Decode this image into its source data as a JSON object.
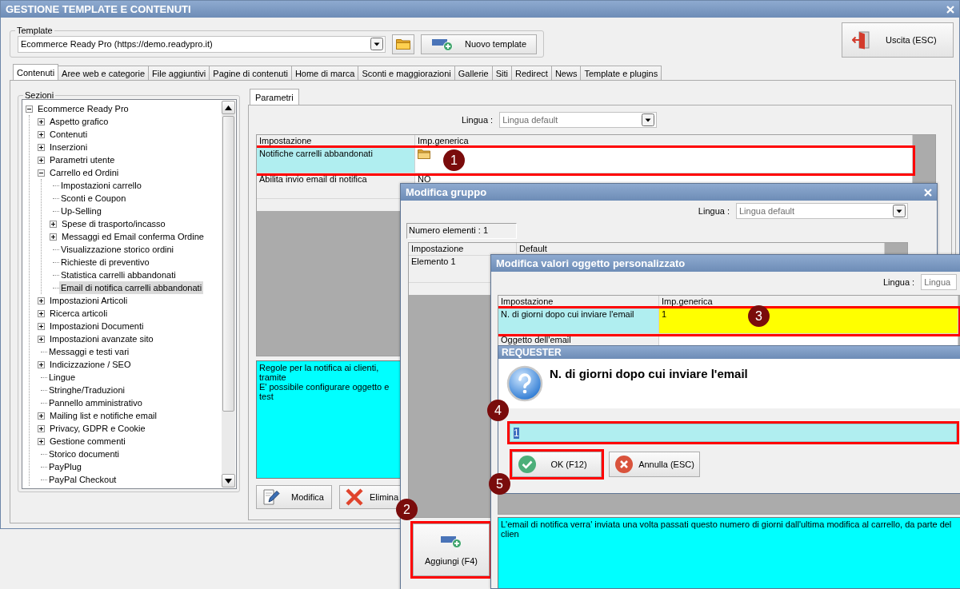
{
  "main_window": {
    "title": "GESTIONE TEMPLATE E CONTENUTI",
    "template": {
      "label": "Template",
      "value": "Ecommerce Ready Pro (https://demo.readypro.it)",
      "new_button": "Nuovo template"
    },
    "exit_button": "Uscita (ESC)",
    "tabs": [
      {
        "label": "Contenuti",
        "selected": true
      },
      {
        "label": "Aree web e categorie",
        "selected": false
      },
      {
        "label": "File aggiuntivi",
        "selected": false
      },
      {
        "label": "Pagine di contenuti",
        "selected": false
      },
      {
        "label": "Home di marca",
        "selected": false
      },
      {
        "label": "Sconti e maggiorazioni",
        "selected": false
      },
      {
        "label": "Gallerie",
        "selected": false
      },
      {
        "label": "Siti",
        "selected": false
      },
      {
        "label": "Redirect",
        "selected": false
      },
      {
        "label": "News",
        "selected": false
      },
      {
        "label": "Template e plugins",
        "selected": false
      }
    ],
    "sections": {
      "label": "Sezioni",
      "tree": [
        {
          "label": "Ecommerce Ready Pro",
          "kind": "group",
          "expanded": true,
          "selected": false,
          "children": [
            {
              "label": "Aspetto grafico",
              "kind": "group",
              "expanded": false,
              "selected": false
            },
            {
              "label": "Contenuti",
              "kind": "group",
              "expanded": false,
              "selected": false
            },
            {
              "label": "Inserzioni",
              "kind": "group",
              "expanded": false,
              "selected": false
            },
            {
              "label": "Parametri utente",
              "kind": "group",
              "expanded": false,
              "selected": false
            },
            {
              "label": "Carrello ed Ordini",
              "kind": "group",
              "expanded": true,
              "selected": false,
              "children": [
                {
                  "label": "Impostazioni carrello",
                  "kind": "leaf",
                  "selected": false
                },
                {
                  "label": "Sconti e Coupon",
                  "kind": "leaf",
                  "selected": false
                },
                {
                  "label": "Up-Selling",
                  "kind": "leaf",
                  "selected": false
                },
                {
                  "label": "Spese di trasporto/incasso",
                  "kind": "group",
                  "expanded": false,
                  "selected": false
                },
                {
                  "label": "Messaggi ed Email conferma Ordine",
                  "kind": "group",
                  "expanded": false,
                  "selected": false
                },
                {
                  "label": "Visualizzazione storico ordini",
                  "kind": "leaf",
                  "selected": false
                },
                {
                  "label": "Richieste di preventivo",
                  "kind": "leaf",
                  "selected": false
                },
                {
                  "label": "Statistica carrelli abbandonati",
                  "kind": "leaf",
                  "selected": false
                },
                {
                  "label": "Email di notifica carrelli abbandonati",
                  "kind": "leaf",
                  "selected": true
                }
              ]
            },
            {
              "label": "Impostazioni Articoli",
              "kind": "group",
              "expanded": false,
              "selected": false
            },
            {
              "label": "Ricerca articoli",
              "kind": "group",
              "expanded": false,
              "selected": false
            },
            {
              "label": "Impostazioni Documenti",
              "kind": "group",
              "expanded": false,
              "selected": false
            },
            {
              "label": "Impostazioni avanzate sito",
              "kind": "group",
              "expanded": false,
              "selected": false
            },
            {
              "label": "Messaggi e testi vari",
              "kind": "leaf",
              "selected": false
            },
            {
              "label": "Indicizzazione / SEO",
              "kind": "group",
              "expanded": false,
              "selected": false
            },
            {
              "label": "Lingue",
              "kind": "leaf",
              "selected": false
            },
            {
              "label": "Stringhe/Traduzioni",
              "kind": "leaf",
              "selected": false
            },
            {
              "label": "Pannello amministrativo",
              "kind": "leaf",
              "selected": false
            },
            {
              "label": "Mailing list e notifiche email",
              "kind": "group",
              "expanded": false,
              "selected": false
            },
            {
              "label": "Privacy, GDPR e Cookie",
              "kind": "group",
              "expanded": false,
              "selected": false
            },
            {
              "label": "Gestione commenti",
              "kind": "group",
              "expanded": false,
              "selected": false
            },
            {
              "label": "Storico documenti",
              "kind": "leaf",
              "selected": false
            },
            {
              "label": "PayPlug",
              "kind": "leaf",
              "selected": false
            },
            {
              "label": "PayPal Checkout",
              "kind": "leaf",
              "selected": false
            }
          ]
        }
      ]
    },
    "panel_tabs": [
      {
        "label": "Parametri",
        "selected": true
      }
    ],
    "language": {
      "label": "Lingua :",
      "value": "Lingua default"
    },
    "grid": {
      "columns": [
        "Impostazione",
        "Imp.generica"
      ],
      "rows": [
        {
          "setting": "Notifiche carrelli abbandonati",
          "kind": "group",
          "selected": true,
          "editing": false,
          "outlined": true
        },
        {
          "setting": "Abilita invio email di notifica",
          "kind": "value",
          "value": "NO",
          "selected": false,
          "editing": false,
          "outlined": false
        }
      ]
    },
    "description": [
      "Regole per la notifica ai clienti, tramite",
      "E' possibile configurare oggetto e test"
    ],
    "buttons": [
      {
        "label": "Modifica",
        "kind": "edit"
      },
      {
        "label": "Elimina",
        "kind": "delete"
      }
    ]
  },
  "group_dialog": {
    "title": "Modifica gruppo",
    "language": {
      "label": "Lingua :",
      "value": "Lingua default"
    },
    "count": "Numero elementi : 1",
    "grid": {
      "columns": [
        "Impostazione",
        "Default"
      ],
      "rows": [
        {
          "setting": "Elemento 1",
          "selected": false,
          "outlined": false
        }
      ]
    },
    "add_button": {
      "label": "Aggiungi (F4)",
      "outlined": true
    }
  },
  "object_dialog": {
    "title": "Modifica valori oggetto personalizzato",
    "language": {
      "label": "Lingua :",
      "value": "Lingua"
    },
    "grid": {
      "columns": [
        "Impostazione",
        "Imp.generica"
      ],
      "rows": [
        {
          "setting": "N. di giorni dopo cui inviare l'email",
          "kind": "value",
          "value": "1",
          "selected": true,
          "editing": true,
          "outlined": true
        },
        {
          "setting": "Oggetto dell'email",
          "kind": "value",
          "selected": false,
          "editing": false,
          "outlined": false
        }
      ]
    },
    "description": "L'email di notifica verra' inviata una volta passati questo numero di giorni dall'ultima modifica al carrello, da parte del clien"
  },
  "requester": {
    "title": "REQUESTER",
    "question": "N. di giorni dopo cui inviare l'email",
    "input": {
      "value": "1",
      "text_selected": true,
      "outlined": true
    },
    "buttons": [
      {
        "label": "OK (F12)",
        "kind": "ok",
        "outlined": true
      },
      {
        "label": "Annulla (ESC)",
        "kind": "cancel",
        "outlined": false
      }
    ]
  },
  "callouts": [
    "1",
    "2",
    "3",
    "4",
    "5"
  ]
}
